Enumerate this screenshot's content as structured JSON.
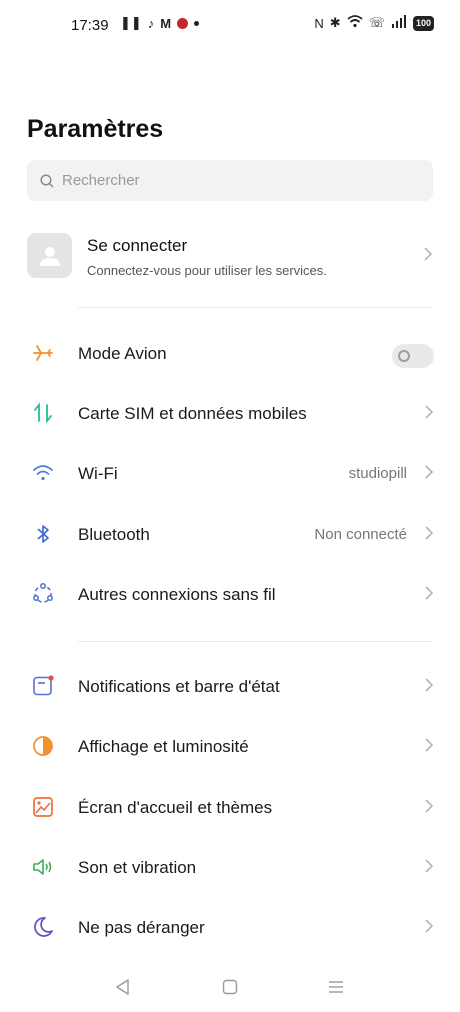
{
  "status_bar": {
    "time": "17:39",
    "battery": "100"
  },
  "page": {
    "title": "Paramètres"
  },
  "search": {
    "placeholder": "Rechercher"
  },
  "account": {
    "title": "Se connecter",
    "subtitle": "Connectez-vous pour utiliser les services."
  },
  "settings": {
    "items": [
      {
        "label": "Mode Avion",
        "value": "",
        "icon": "airplane-icon",
        "control": "toggle",
        "toggle_on": false
      },
      {
        "label": "Carte SIM et données mobiles",
        "value": "",
        "icon": "sim-data-icon"
      },
      {
        "label": "Wi-Fi",
        "value": "studiopill",
        "icon": "wifi-icon"
      },
      {
        "label": "Bluetooth",
        "value": "Non connecté",
        "icon": "bluetooth-icon"
      },
      {
        "label": "Autres connexions sans fil",
        "value": "",
        "icon": "connections-icon"
      },
      {
        "label": "Notifications et barre d'état",
        "value": "",
        "icon": "notification-icon"
      },
      {
        "label": "Affichage et luminosité",
        "value": "",
        "icon": "display-icon"
      },
      {
        "label": "Écran d'accueil et thèmes",
        "value": "",
        "icon": "home-screen-icon"
      },
      {
        "label": "Son et vibration",
        "value": "",
        "icon": "sound-icon"
      },
      {
        "label": "Ne pas déranger",
        "value": "",
        "icon": "moon-icon"
      }
    ]
  },
  "colors": {
    "airplane": "#f0932b",
    "sim": "#2bb89a",
    "wifi": "#4a7bd6",
    "bluetooth": "#3f6fd1",
    "connections": "#4a6fd0",
    "notification": "#5a6fd6",
    "display": "#f0932b",
    "home_screen": "#ef6f3c",
    "sound": "#3cae5a",
    "moon": "#5b4fc7"
  }
}
